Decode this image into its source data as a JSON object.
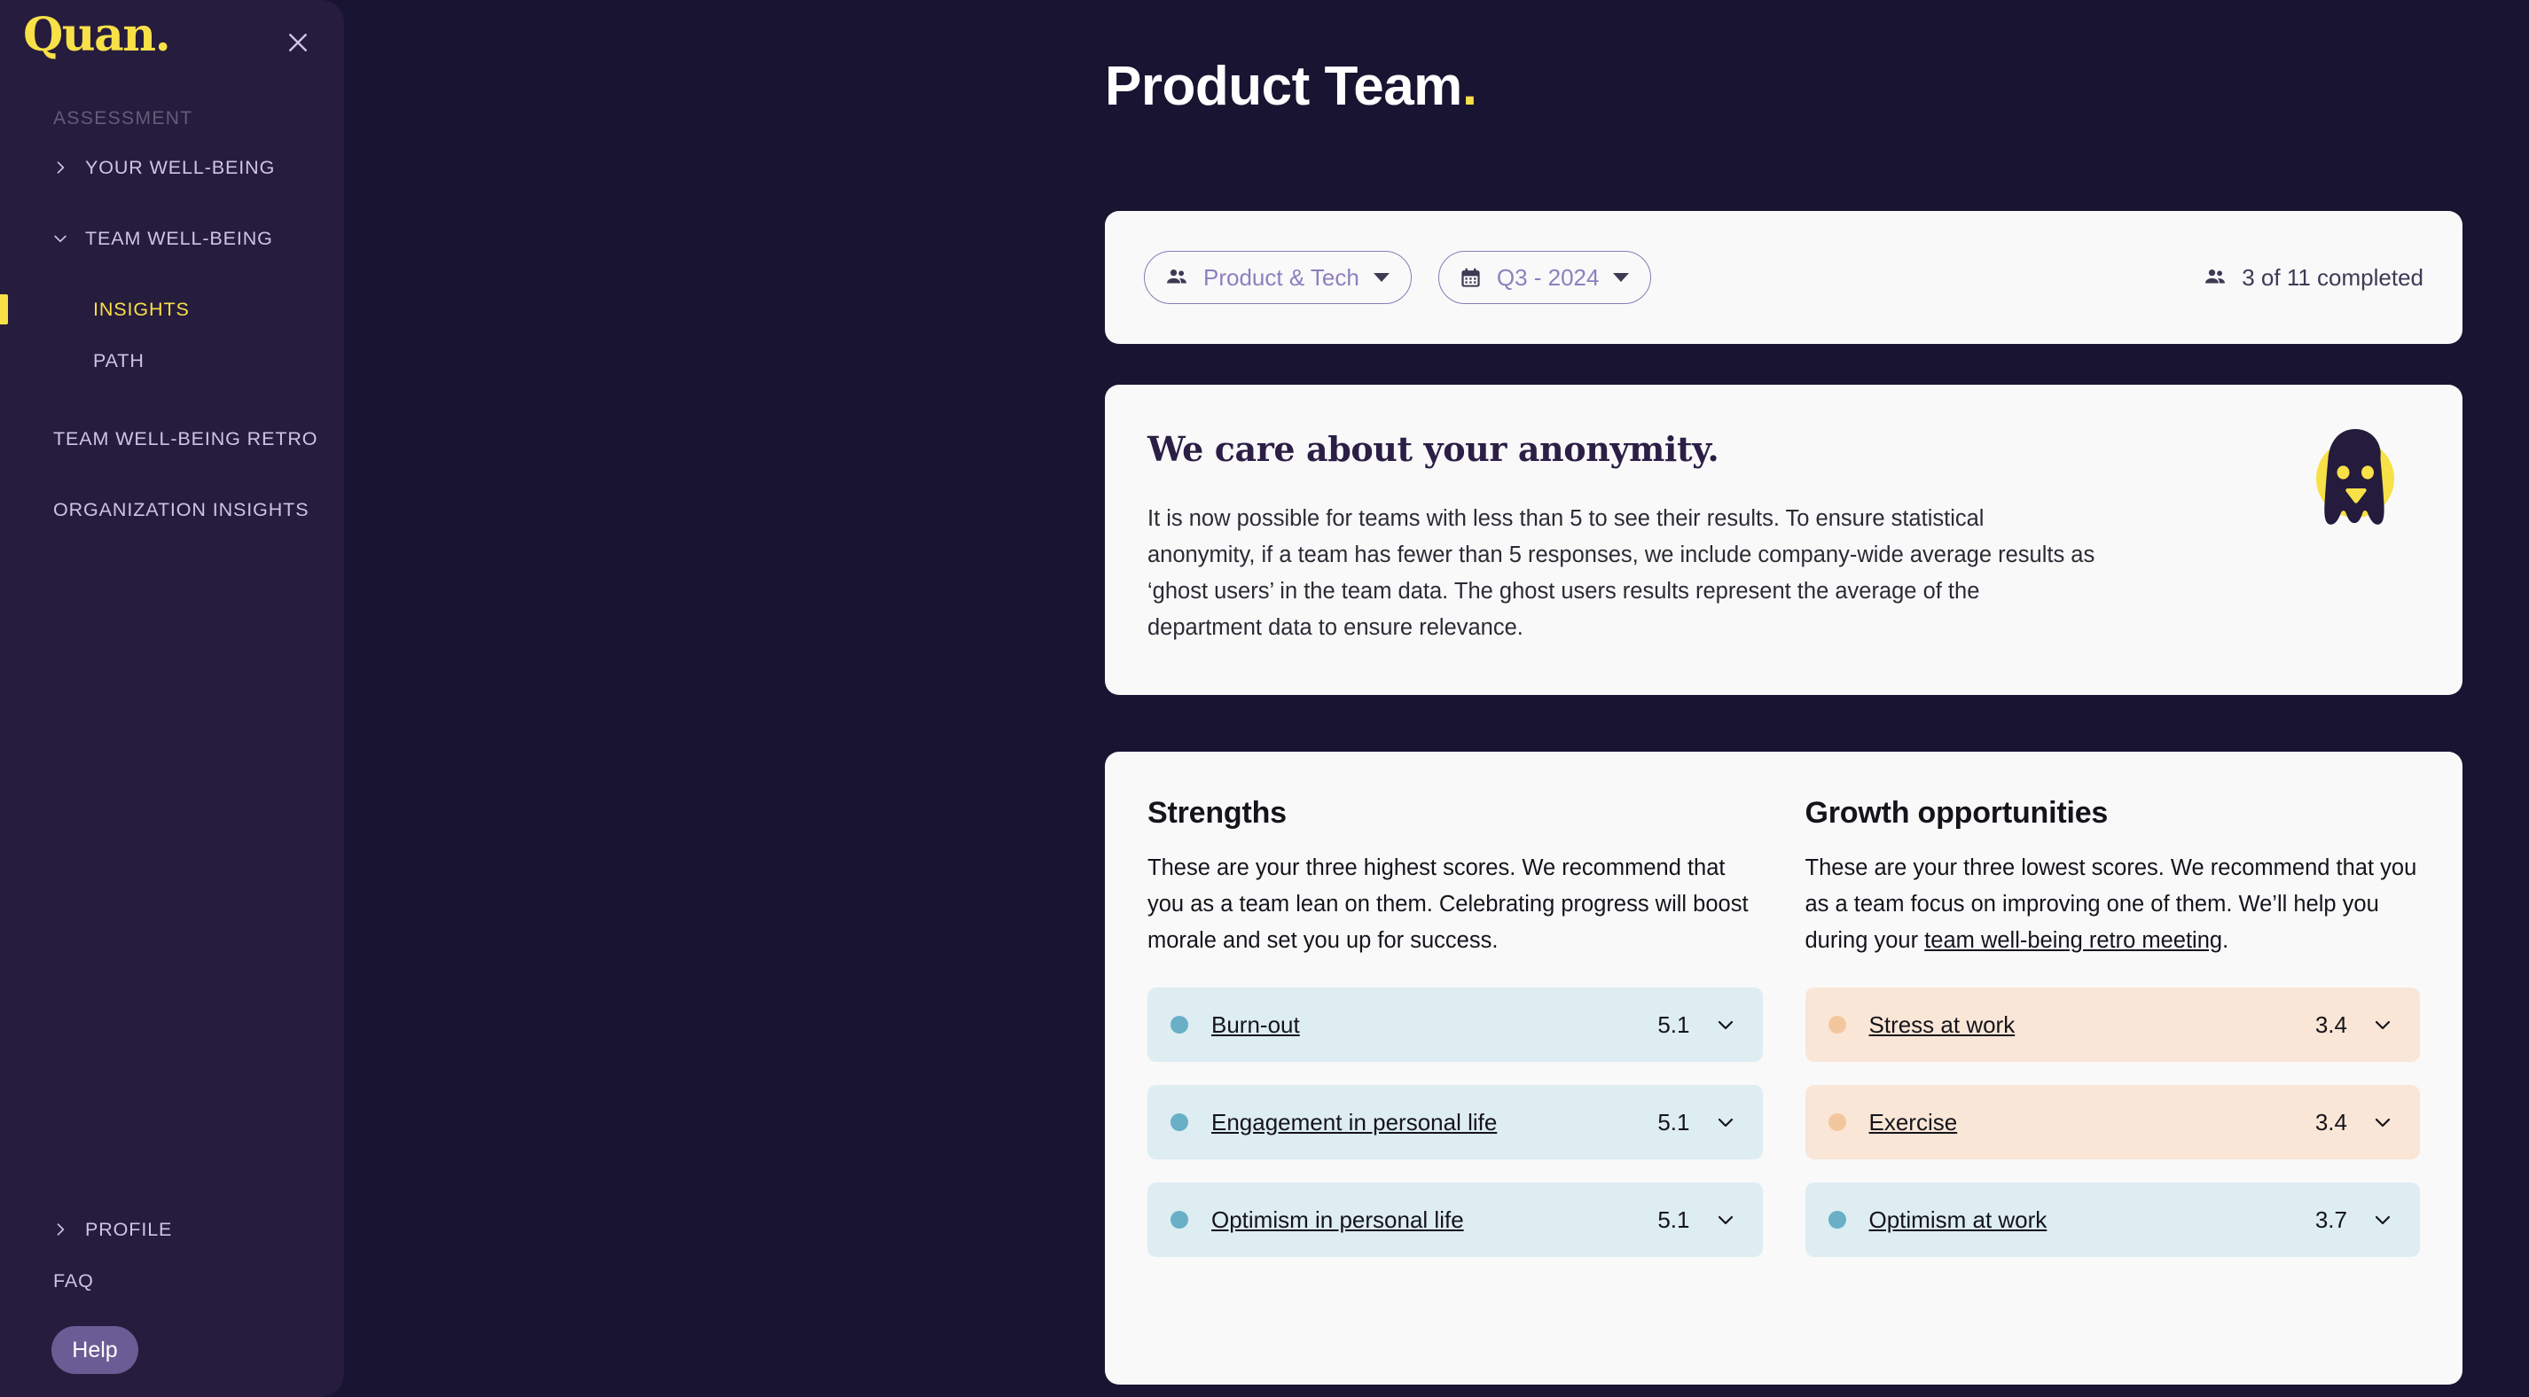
{
  "sidebar": {
    "logo": "Quan.",
    "close_icon": "close-icon",
    "section_label": "ASSESSMENT",
    "nav": [
      {
        "label": "YOUR WELL-BEING",
        "icon": "chevron-right-icon"
      },
      {
        "label": "TEAM WELL-BEING",
        "icon": "chevron-down-icon"
      }
    ],
    "sub_nav": [
      {
        "label": "INSIGHTS",
        "active": true
      },
      {
        "label": "PATH",
        "active": false
      }
    ],
    "links": [
      {
        "label": "TEAM WELL-BEING RETRO"
      },
      {
        "label": "ORGANIZATION INSIGHTS"
      }
    ],
    "bottom": {
      "profile": "PROFILE",
      "faq": "FAQ",
      "help": "Help"
    }
  },
  "header": {
    "title": "Product Team",
    "title_dot": "."
  },
  "filters": {
    "team": {
      "label": "Product & Tech",
      "icon": "people-icon",
      "caret": "caret-down-icon"
    },
    "period": {
      "label": "Q3 - 2024",
      "icon": "calendar-icon",
      "caret": "caret-down-icon"
    },
    "completed": {
      "text": "3 of 11 completed",
      "icon": "people-icon"
    }
  },
  "anonymity": {
    "title": "We care about your anonymity.",
    "body": "It is now possible for teams with less than 5 to see their results. To ensure statistical anonymity, if a team has fewer than 5 responses, we include company-wide average results as ‘ghost users’ in the team data. The ghost users results represent the average of the department data to ensure relevance.",
    "illustration": "ghost-illustration"
  },
  "insights": {
    "strengths": {
      "title": "Strengths",
      "desc": "These are your three highest scores. We recommend that you as a team lean on them. Celebrating progress will boost morale and set you up for success.",
      "items": [
        {
          "label": "Burn-out",
          "value": "5.1",
          "tone": "blue"
        },
        {
          "label": "Engagement in personal life",
          "value": "5.1",
          "tone": "blue"
        },
        {
          "label": "Optimism in personal life",
          "value": "5.1",
          "tone": "blue"
        }
      ]
    },
    "growth": {
      "title": "Growth opportunities",
      "desc_before": "These are your three lowest scores. We recommend that you as a team focus on improving one of them. We’ll help you during your ",
      "desc_link": "team well-being retro meeting",
      "desc_after": ".",
      "items": [
        {
          "label": "Stress at work",
          "value": "3.4",
          "tone": "peach"
        },
        {
          "label": "Exercise",
          "value": "3.4",
          "tone": "peach"
        },
        {
          "label": "Optimism at work",
          "value": "3.7",
          "tone": "blue"
        }
      ]
    }
  },
  "colors": {
    "brand_yellow": "#F8E047",
    "sidebar_bg": "#261C3D",
    "page_bg": "#191431",
    "card_bg": "#F9F9FA",
    "pill_border": "#8A7CB3",
    "pill_text": "#8E7FBE",
    "score_blue_bg": "#DDEDF2",
    "score_blue_dot": "#69AFC6",
    "score_peach_bg": "#FAE6D7",
    "score_peach_dot": "#F3C79E",
    "help_btn_bg": "#6B5C95"
  }
}
